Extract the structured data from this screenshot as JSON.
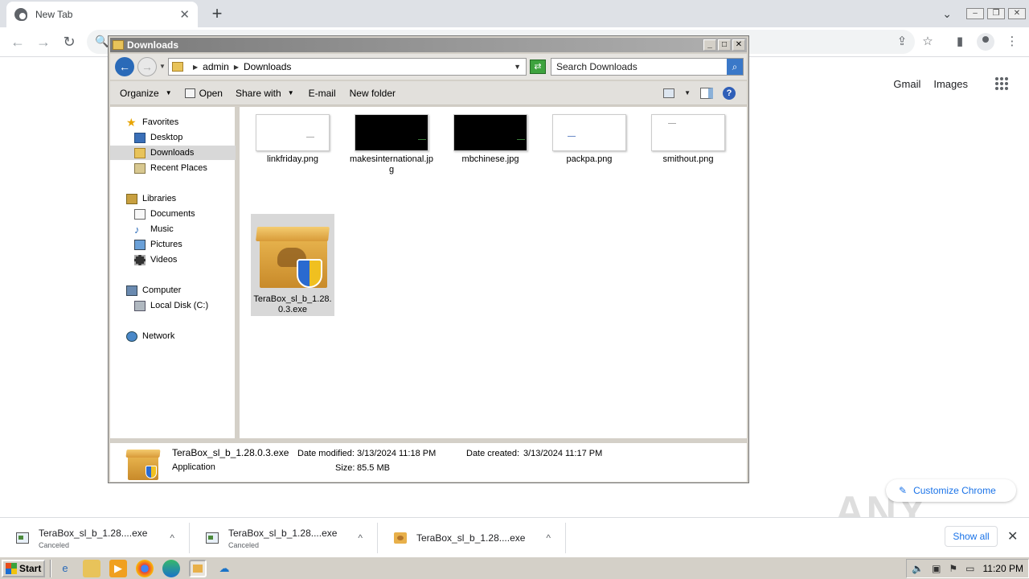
{
  "browser": {
    "tab_title": "New Tab",
    "new_tab": "+",
    "links": {
      "gmail": "Gmail",
      "images": "Images"
    },
    "customize_label": "Customize Chrome",
    "customize_icon": "pencil-icon"
  },
  "explorer": {
    "title": "Downloads",
    "breadcrumb": [
      "admin",
      "Downloads"
    ],
    "search_placeholder": "Search Downloads",
    "toolbar": {
      "organize": "Organize",
      "open": "Open",
      "share_with": "Share with",
      "email": "E-mail",
      "new_folder": "New folder"
    },
    "nav": {
      "favorites": "Favorites",
      "desktop": "Desktop",
      "downloads": "Downloads",
      "recent_places": "Recent Places",
      "libraries": "Libraries",
      "documents": "Documents",
      "music": "Music",
      "pictures": "Pictures",
      "videos": "Videos",
      "computer": "Computer",
      "local_disk": "Local Disk (C:)",
      "network": "Network"
    },
    "files": [
      {
        "name": "linkfriday.png",
        "thumb": "light"
      },
      {
        "name": "makesinternational.jpg",
        "thumb": "dark"
      },
      {
        "name": "mbchinese.jpg",
        "thumb": "dark"
      },
      {
        "name": "packpa.png",
        "thumb": "light"
      },
      {
        "name": "smithout.png",
        "thumb": "light"
      },
      {
        "name": "TeraBox_sl_b_1.28.0.3.exe",
        "thumb": "box"
      }
    ],
    "details": {
      "name": "TeraBox_sl_b_1.28.0.3.exe",
      "type": "Application",
      "date_modified_label": "Date modified:",
      "date_modified": "3/13/2024 11:18 PM",
      "date_created_label": "Date created:",
      "date_created": "3/13/2024 11:17 PM",
      "size_label": "Size:",
      "size": "85.5 MB"
    }
  },
  "downloads": {
    "items": [
      {
        "name": "TeraBox_sl_b_1.28....exe",
        "status": "Canceled"
      },
      {
        "name": "TeraBox_sl_b_1.28....exe",
        "status": "Canceled"
      },
      {
        "name": "TeraBox_sl_b_1.28....exe",
        "status": ""
      }
    ],
    "show_all": "Show all"
  },
  "watermark": "ANY RUN",
  "taskbar": {
    "start": "Start",
    "clock": "11:20 PM"
  }
}
